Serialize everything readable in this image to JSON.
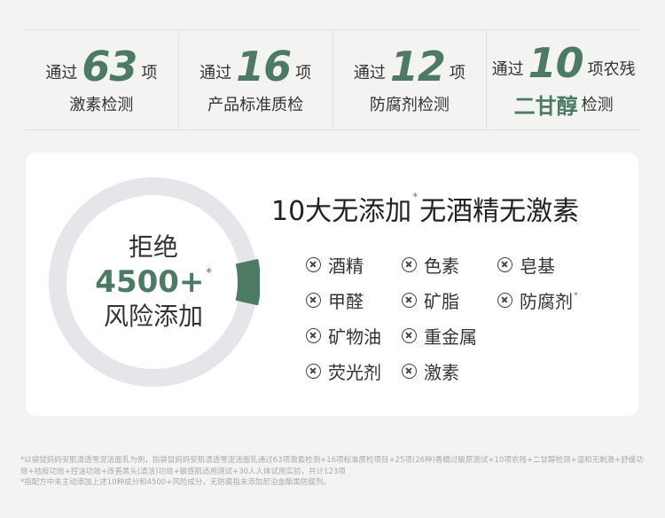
{
  "stats": [
    {
      "prefix": "通过",
      "number": "63",
      "suffix": "项",
      "line2": "激素检测"
    },
    {
      "prefix": "通过",
      "number": "16",
      "suffix": "项",
      "line2": "产品标准质检"
    },
    {
      "prefix": "通过",
      "number": "12",
      "suffix": "项",
      "line2": "防腐剂检测"
    },
    {
      "prefix": "通过",
      "number": "10",
      "suffix": "项农残",
      "line2_highlight": "二甘醇",
      "line2": "检测"
    }
  ],
  "ring": {
    "line1": "拒绝",
    "number": "4500+",
    "mark": "*",
    "line3": "风险添加",
    "highlight_fraction": 0.07,
    "colors": {
      "track": "#e6e6ea",
      "highlight": "#4c7a62"
    }
  },
  "headline": {
    "part1": "10大无添加",
    "mark": "*",
    "part2": "无酒精无激素"
  },
  "items": [
    [
      "酒精",
      "色素",
      "皂基"
    ],
    [
      "甲醛",
      "矿脂",
      "防腐剂"
    ],
    [
      "矿物油",
      "重金属"
    ],
    [
      "荧光剂",
      "激素"
    ]
  ],
  "item_mark": "*",
  "footnotes": [
    "*以袋鼠妈妈安肌清透雪泥洁面乳为例，指袋鼠妈妈安肌清透雪泥洁面乳通过63项激素检测+16项标准质检项目+25项(26种)香精过敏原测试+10项农残+二甘醇检测+温和无刺激+舒缓功效+祛痘功效+控油功效+改善黑头(清洁)功效+敏感肌适用测试+30人人体试用实验，共计123项",
    "*指配方中未主动添加上述10种成分和4500+风险成分，无防腐指未添加尼泊金酯类防腐剂。"
  ],
  "accent": "#4c7a62"
}
